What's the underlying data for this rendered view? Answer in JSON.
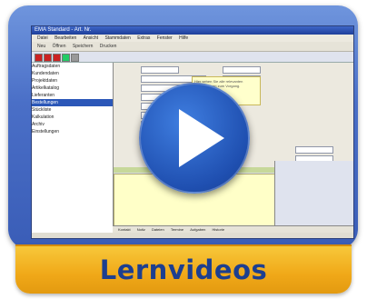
{
  "app_window": {
    "title": "EMA Standard - Art. Nr.",
    "menu": [
      "Datei",
      "Bearbeiten",
      "Ansicht",
      "Stammdaten",
      "Extras",
      "Fenster",
      "Hilfe"
    ],
    "toolbar_labels": [
      "Neu",
      "Öffnen",
      "Speichern",
      "Drucken"
    ],
    "tree_items": [
      "Auftragsdaten",
      "Kundendaten",
      "Projektdaten",
      "Artikelkatalog",
      "Lieferanten",
      "Bestellungen",
      "Stückliste",
      "Kalkulation",
      "Archiv",
      "Einstellungen"
    ],
    "bottom_tabs": [
      "Kontakt",
      "Notiz",
      "Dateien",
      "Termine",
      "Aufgaben",
      "Historie"
    ],
    "tooltip_text": "Hier sehen Sie alle relevanten Informationen zum Vorgang."
  },
  "play_button": {
    "icon": "play-icon",
    "color": "#2a5fc4"
  },
  "banner": {
    "label": "Lernvideos",
    "color": "#f2b120",
    "text_color": "#1d3f8f"
  }
}
